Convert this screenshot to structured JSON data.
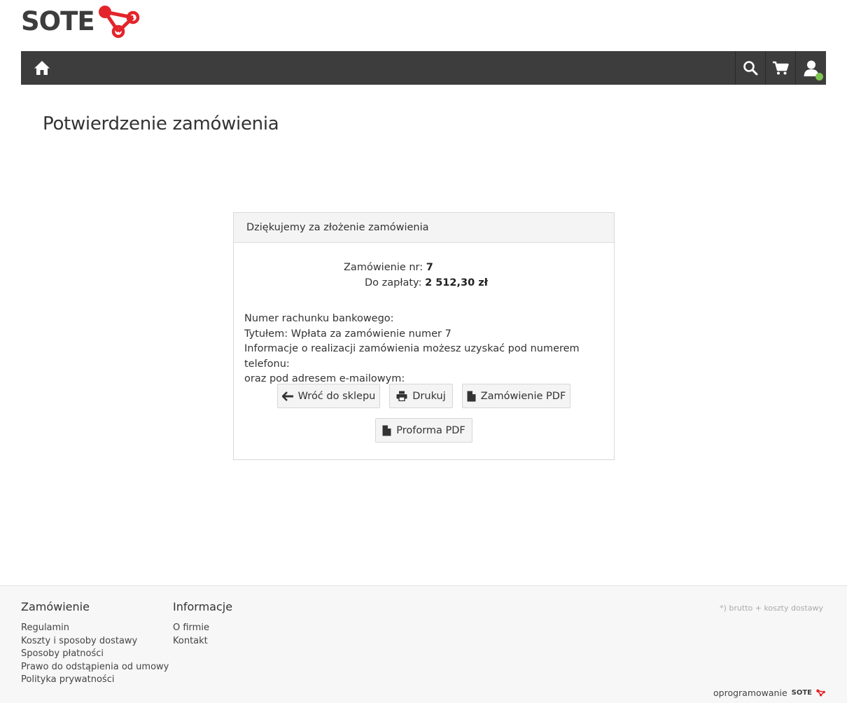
{
  "brand": {
    "name": "SOTE",
    "accent_color": "#e3242b"
  },
  "navbar": {
    "home_icon": "home-icon",
    "search_icon": "search-icon",
    "cart_icon": "cart-icon",
    "user_icon": "user-icon",
    "user_status_color": "#7ec453"
  },
  "page": {
    "title": "Potwierdzenie zamówienia"
  },
  "confirmation": {
    "heading": "Dziękujemy za złożenie zamówienia",
    "order_label": "Zamówienie nr:",
    "order_number": "7",
    "amount_label": "Do zapłaty:",
    "amount_value": "2 512,30 zł",
    "info_lines": [
      "Numer rachunku bankowego:",
      "Tytułem: Wpłata za zamówienie numer 7",
      "Informacje o realizacji zamówienia możesz uzyskać pod numerem telefonu:",
      "oraz pod adresem e-mailowym:"
    ],
    "buttons": {
      "back": "Wróć do sklepu",
      "print": "Drukuj",
      "order_pdf": "Zamówienie PDF",
      "proforma_pdf": "Proforma PDF"
    }
  },
  "footer": {
    "col1": {
      "heading": "Zamówienie",
      "links": [
        "Regulamin",
        "Koszty i sposoby dostawy",
        "Sposoby płatności",
        "Prawo do odstąpienia od umowy",
        "Polityka prywatności"
      ]
    },
    "col2": {
      "heading": "Informacje",
      "links": [
        "O firmie",
        "Kontakt"
      ]
    },
    "note": "*) brutto + koszty dostawy",
    "credit": "oprogramowanie",
    "credit_brand": "SOTE"
  }
}
